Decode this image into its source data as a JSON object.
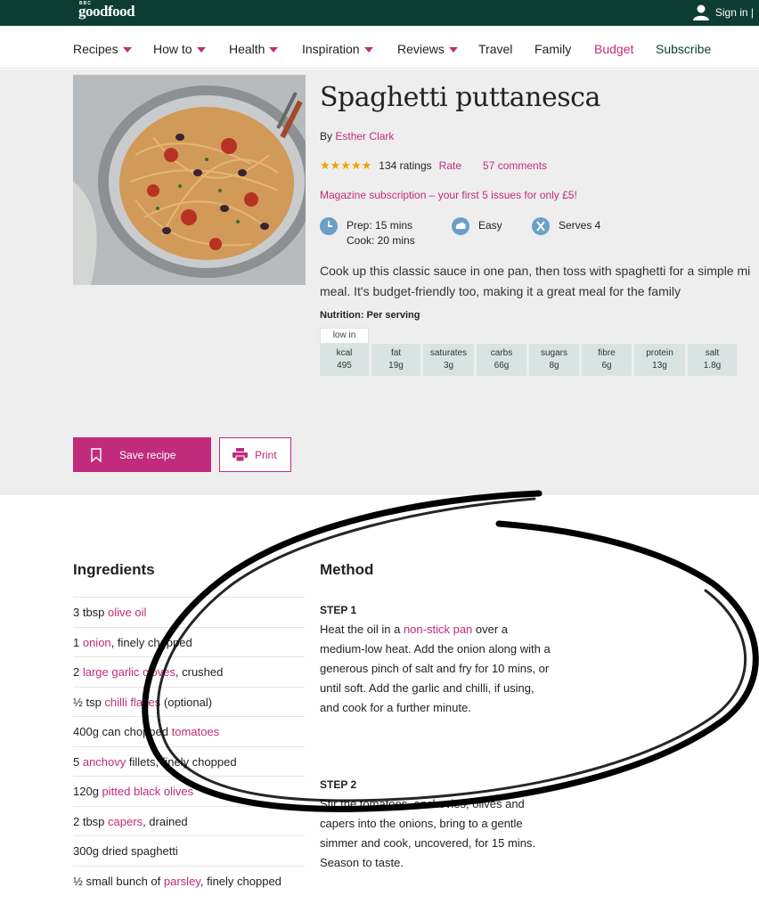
{
  "site": {
    "bbc_label": "BBC",
    "logo": "goodfood",
    "signin": "Sign in |"
  },
  "nav": {
    "recipes": "Recipes",
    "howto": "How to",
    "health": "Health",
    "inspiration": "Inspiration",
    "reviews": "Reviews",
    "travel": "Travel",
    "family": "Family",
    "budget": "Budget",
    "subscribe": "Subscribe"
  },
  "recipe": {
    "title": "Spaghetti puttanesca",
    "by": "By",
    "author": "Esther Clark",
    "stars": "★★★★★",
    "rating_value": 5,
    "ratings": "134 ratings",
    "rate": "Rate",
    "comments": "57 comments",
    "promo": "Magazine subscription – your first 5 issues for only £5!",
    "prep": "Prep: 15 mins",
    "cook": "Cook: 20 mins",
    "difficulty": "Easy",
    "serves": "Serves 4",
    "desc_line1": "Cook up this classic sauce in one pan, then toss with spaghetti for a simple mi",
    "desc_line2": "meal. It's budget-friendly too, making it a great meal for the family",
    "nutrition_title": "Nutrition: Per serving",
    "low_in": "low in",
    "nutrition": [
      {
        "label": "kcal",
        "value": "495"
      },
      {
        "label": "fat",
        "value": "19g"
      },
      {
        "label": "saturates",
        "value": "3g"
      },
      {
        "label": "carbs",
        "value": "66g"
      },
      {
        "label": "sugars",
        "value": "8g"
      },
      {
        "label": "fibre",
        "value": "6g"
      },
      {
        "label": "protein",
        "value": "13g"
      },
      {
        "label": "salt",
        "value": "1.8g"
      }
    ],
    "save": "Save recipe",
    "print": "Print"
  },
  "ingredients": {
    "title": "Ingredients",
    "items": [
      {
        "pre": "3 tbsp ",
        "link": "olive oil",
        "post": ""
      },
      {
        "pre": "1 ",
        "link": "onion",
        "post": ", finely chopped"
      },
      {
        "pre": "2 ",
        "link": "large garlic cloves",
        "post": ", crushed"
      },
      {
        "pre": "½ tsp ",
        "link": "chilli flakes",
        "post": " (optional)"
      },
      {
        "pre": "400g can chopped ",
        "link": "tomatoes",
        "post": ""
      },
      {
        "pre": "5 ",
        "link": "anchovy",
        "post": " fillets, finely chopped"
      },
      {
        "pre": "120g ",
        "link": "pitted black olives",
        "post": ""
      },
      {
        "pre": "2 tbsp ",
        "link": "capers",
        "post": ", drained"
      },
      {
        "pre": "300g dried spaghetti",
        "link": "",
        "post": ""
      },
      {
        "pre": "½ small bunch of ",
        "link": "parsley",
        "post": ", finely chopped"
      }
    ]
  },
  "method": {
    "title": "Method",
    "step1_label": "STEP 1",
    "step1_pre": "Heat the oil in a ",
    "step1_link": "non-stick pan",
    "step1_post": " over a medium-low heat. Add the onion along with a generous pinch of salt and fry for 10 mins, or until soft. Add the garlic and chilli, if using, and cook for a further minute.",
    "step2_label": "STEP 2",
    "step2_text": "Stir the tomatoes, anchovies, olives and capers into the onions, bring to a gentle simmer and cook, uncovered, for 15 mins. Season to taste."
  },
  "colors": {
    "brand_green": "#0d3c32",
    "accent_pink": "#c02c7b",
    "star": "#f2a200",
    "icon_blue": "#6a9fc6"
  }
}
